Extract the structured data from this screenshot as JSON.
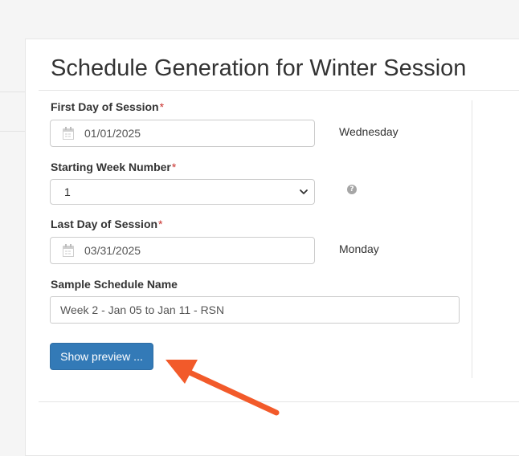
{
  "page": {
    "title": "Schedule Generation for Winter Session"
  },
  "form": {
    "first_day": {
      "label": "First Day of Session",
      "required_mark": "*",
      "value": "01/01/2025",
      "weekday": "Wednesday"
    },
    "starting_week": {
      "label": "Starting Week Number",
      "required_mark": "*",
      "selected": "1",
      "help_icon": "question-circle-icon"
    },
    "last_day": {
      "label": "Last Day of Session",
      "required_mark": "*",
      "value": "03/31/2025",
      "weekday": "Monday"
    },
    "sample_name": {
      "label": "Sample Schedule Name",
      "value": "Week 2 - Jan 05 to Jan 11 - RSN"
    },
    "preview_button": {
      "label": "Show preview ..."
    }
  },
  "colors": {
    "primary": "#337ab7",
    "required": "#c9302c",
    "annotation_arrow": "#f25a2a"
  }
}
